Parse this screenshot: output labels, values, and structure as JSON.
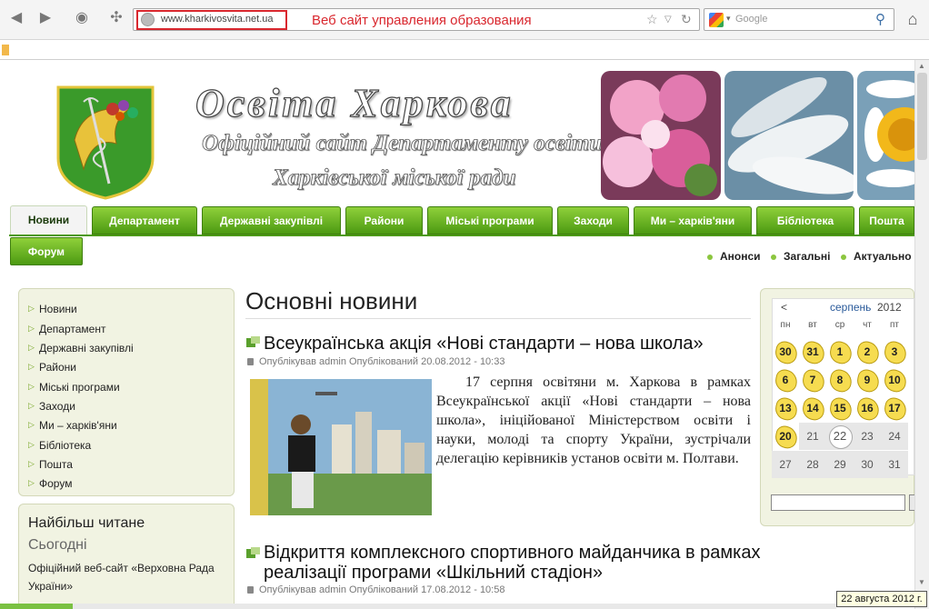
{
  "browser": {
    "url": "www.kharkivosvita.net.ua",
    "url_annotation": "Веб сайт управления образования",
    "search_placeholder": "Google"
  },
  "header": {
    "title": "Освіта Харкова",
    "subtitle_line1": "Офіційний сайт Департаменту освіти",
    "subtitle_line2": "Харківської міської ради"
  },
  "menu": {
    "tabs": [
      {
        "label": "Новини",
        "active": true
      },
      {
        "label": "Департамент"
      },
      {
        "label": "Державні закупівлі"
      },
      {
        "label": "Райони"
      },
      {
        "label": "Міські програми"
      },
      {
        "label": "Заходи"
      },
      {
        "label": "Ми – харків'яни"
      },
      {
        "label": "Бібліотека"
      },
      {
        "label": "Пошта"
      }
    ],
    "forum_label": "Форум",
    "subnav": [
      "Анонси",
      "Загальні",
      "Актуально"
    ]
  },
  "leftnav": {
    "items": [
      "Новини",
      "Департамент",
      "Державні закупівлі",
      "Райони",
      "Міські програми",
      "Заходи",
      "Ми – харків'яни",
      "Бібліотека",
      "Пошта",
      "Форум"
    ]
  },
  "most_read": {
    "title": "Найбільш читане",
    "period": "Сьогодні",
    "item1": "Офіційний веб-сайт «Верховна Рада",
    "item1_cont": "України»"
  },
  "main": {
    "title": "Основні новини",
    "articles": [
      {
        "title": "Всеукраїнська акція «Нові стандарти – нова школа»",
        "meta": "Опублікував admin Опублікований 20.08.2012 - 10:33",
        "body": "17 серпня освітяни м. Харкова в рамках Всеукраїнської акції «Нові стандарти – нова школа», ініційованої Міністерством освіти і науки, молоді та спорту України, зустрічали делегацію керівників установ освіти м. Полтави."
      },
      {
        "title_line1": "Відкриття комплексного спортивного майданчика в рамках",
        "title_line2": "реалізації програми «Шкільний стадіон»",
        "meta": "Опублікував admin Опублікований 17.08.2012 - 10:58"
      }
    ]
  },
  "calendar": {
    "prev": "<",
    "month": "серпень",
    "year": "2012",
    "dow": [
      "пн",
      "вт",
      "ср",
      "чт",
      "пт"
    ],
    "rows": [
      [
        {
          "d": "30",
          "star": true
        },
        {
          "d": "31",
          "star": true
        },
        {
          "d": "1",
          "star": true
        },
        {
          "d": "2",
          "star": true
        },
        {
          "d": "3",
          "star": true
        }
      ],
      [
        {
          "d": "6",
          "star": true
        },
        {
          "d": "7",
          "star": true
        },
        {
          "d": "8",
          "star": true
        },
        {
          "d": "9",
          "star": true
        },
        {
          "d": "10",
          "star": true
        }
      ],
      [
        {
          "d": "13",
          "star": true
        },
        {
          "d": "14",
          "star": true
        },
        {
          "d": "15",
          "star": true
        },
        {
          "d": "16",
          "star": true
        },
        {
          "d": "17",
          "star": true
        }
      ],
      [
        {
          "d": "20",
          "star": true
        },
        {
          "d": "21"
        },
        {
          "d": "22",
          "today": true
        },
        {
          "d": "23"
        },
        {
          "d": "24"
        }
      ],
      [
        {
          "d": "27"
        },
        {
          "d": "28"
        },
        {
          "d": "29"
        },
        {
          "d": "30"
        },
        {
          "d": "31"
        }
      ]
    ]
  },
  "tooltip": "22 августа 2012 г.",
  "colors": {
    "accent": "#4c9a12",
    "highlight": "#d9272e",
    "sidebar_bg": "#f1f3e2"
  }
}
